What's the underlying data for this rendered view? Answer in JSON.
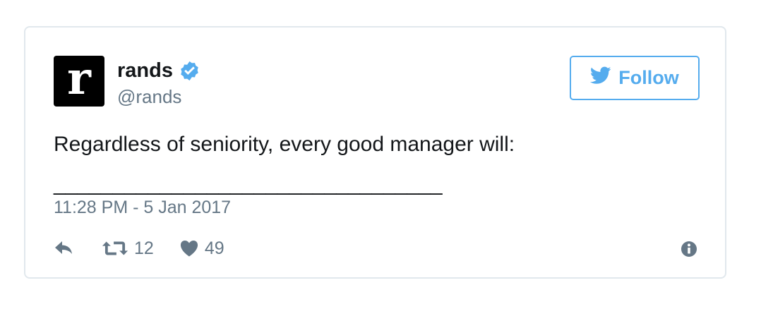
{
  "author": {
    "avatar_letter": "r",
    "display_name": "rands",
    "handle": "@rands",
    "verified": true
  },
  "follow_button": {
    "label": "Follow"
  },
  "tweet": {
    "text": "Regardless of seniority, every good manager will:",
    "blank_line": "_________________________________",
    "timestamp": "11:28 PM - 5 Jan 2017"
  },
  "actions": {
    "retweet_count": "12",
    "like_count": "49"
  },
  "colors": {
    "accent": "#55acee",
    "muted": "#657786",
    "text": "#14171a",
    "border": "#e1e8ed"
  },
  "icons": [
    "verified-badge-icon",
    "twitter-bird-icon",
    "reply-icon",
    "retweet-icon",
    "heart-icon",
    "info-icon"
  ]
}
